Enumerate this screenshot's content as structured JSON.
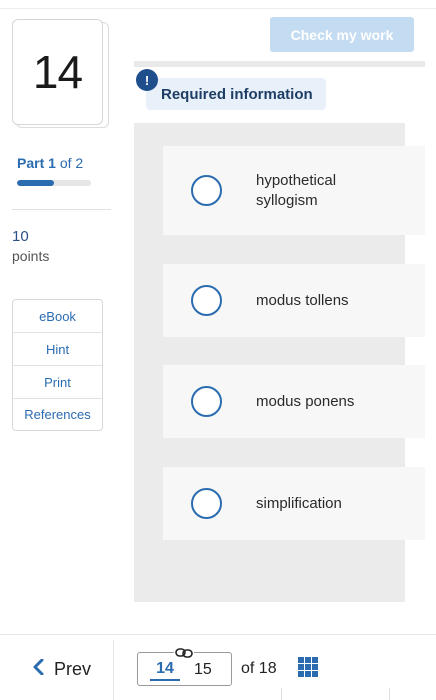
{
  "question": {
    "number": "14"
  },
  "part": {
    "label_prefix": "Part",
    "current": "1",
    "label_suffix": "of 2",
    "progress_fraction": 0.5
  },
  "points": {
    "value": "10",
    "label": "points"
  },
  "tools": [
    {
      "label": "eBook"
    },
    {
      "label": "Hint"
    },
    {
      "label": "Print"
    },
    {
      "label": "References"
    }
  ],
  "header": {
    "check_label": "Check my work",
    "required_info": "Required information",
    "alert_glyph": "!"
  },
  "options": [
    {
      "label": "hypothetical syllogism"
    },
    {
      "label": "modus tollens"
    },
    {
      "label": "modus ponens"
    },
    {
      "label": "simplification"
    }
  ],
  "footer": {
    "prev_label": "Prev",
    "prev_icon": "chevron-left-icon",
    "current_page": "14",
    "next_page": "15",
    "of_total": "of 18",
    "grid_icon": "grid-icon",
    "link_icon": "link-icon"
  },
  "colors": {
    "accent": "#2b6cb0",
    "check_button": "#c3dcf2",
    "required_bg": "#e8f0fa",
    "alert": "#1f4e8c"
  }
}
